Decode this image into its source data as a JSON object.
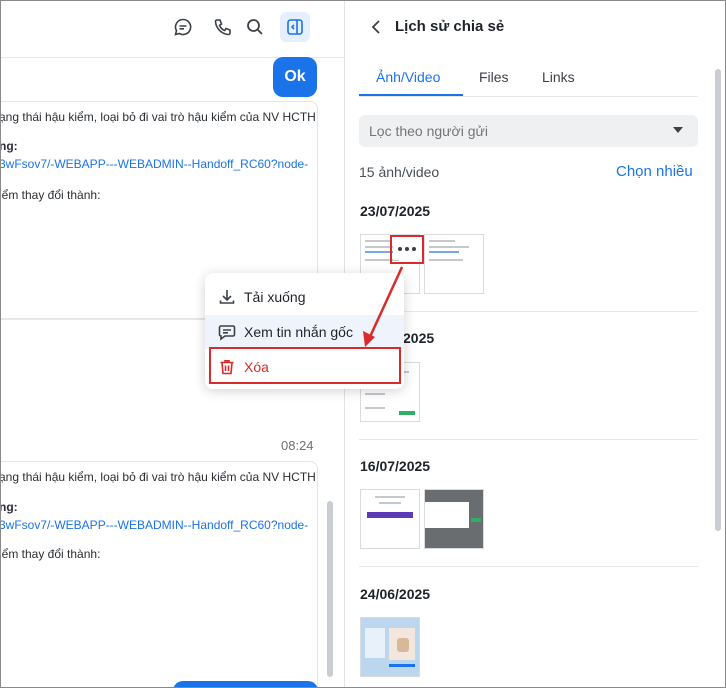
{
  "chat": {
    "ok_label": "Ok",
    "time": "08:24",
    "message1": {
      "line1": "ạng thái hậu kiểm, loại bỏ đi vai trò hậu kiểm của NV HCTH",
      "line2": "ng:",
      "line3": "3wFsov7/-WEBAPP---WEBADMIN--Handoff_RC60?node-",
      "line4": "iểm thay đổi thành:"
    },
    "message2": {
      "line1": "ạng thái hậu kiểm, loại bỏ đi vai trò hậu kiểm của NV HCTH",
      "line2": "ng:",
      "line3": "3wFsov7/-WEBAPP---WEBADMIN--Handoff_RC60?node-",
      "line4": "iểm thay đổi thành:"
    }
  },
  "toolbar": {
    "icons": [
      "chat-bubble-icon",
      "phone-icon",
      "search-icon",
      "sidebar-panel-icon"
    ]
  },
  "panel": {
    "title": "Lịch sử chia sẻ",
    "tabs": [
      {
        "label": "Ảnh/Video",
        "active": true
      },
      {
        "label": "Files",
        "active": false
      },
      {
        "label": "Links",
        "active": false
      }
    ],
    "filter_placeholder": "Lọc theo người gửi",
    "count": "15 ảnh/video",
    "select_many": "Chọn nhiều",
    "sections": [
      {
        "date": "23/07/2025"
      },
      {
        "date": "2025"
      },
      {
        "date": "16/07/2025"
      },
      {
        "date": "24/06/2025"
      }
    ]
  },
  "context_menu": {
    "items": [
      {
        "label": "Tải xuống",
        "icon": "download-icon"
      },
      {
        "label": "Xem tin nhắn gốc",
        "icon": "message-icon"
      },
      {
        "label": "Xóa",
        "icon": "trash-icon"
      }
    ]
  },
  "colors": {
    "accent": "#1a73e8",
    "danger": "#d92b2b",
    "annotation": "#d92b2b"
  }
}
